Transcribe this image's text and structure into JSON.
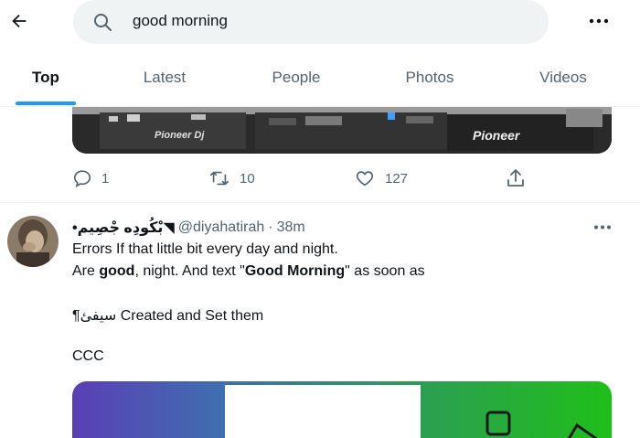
{
  "search": {
    "query": "good morning"
  },
  "tabs": [
    {
      "label": "Top"
    },
    {
      "label": "Latest"
    },
    {
      "label": "People"
    },
    {
      "label": "Photos"
    },
    {
      "label": "Videos"
    }
  ],
  "prev_tweet": {
    "media_brand_left": "Pioneer Dj",
    "media_brand_right": "Pioneer",
    "replies": "1",
    "retweets": "10",
    "likes": "127"
  },
  "tweet": {
    "display_name": "•بْكُودِه جْصِيم◥",
    "handle": "@diyahatirah",
    "separator": "·",
    "time": "38m",
    "line1": "Errors If that little bit every day and night.",
    "line2_a": "Are ",
    "line2_b": "good",
    "line2_c": ", night. And text \"",
    "line2_d": "Good Morning",
    "line2_e": "\" as soon as",
    "line3": "¶سيفئ Created and Set them",
    "line4": "CCC"
  },
  "colors": {
    "accent": "#1d9bf0",
    "muted": "#536471",
    "search_bg": "#eff3f4"
  },
  "icons": [
    "back-arrow-icon",
    "search-icon",
    "more-icon",
    "reply-icon",
    "retweet-icon",
    "like-icon",
    "share-icon"
  ]
}
